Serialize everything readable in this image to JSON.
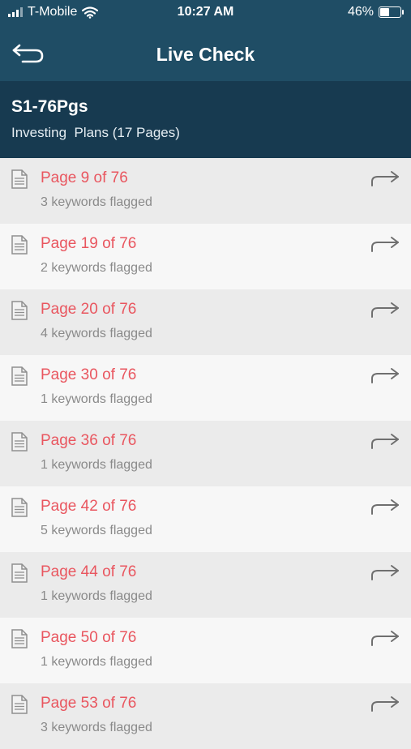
{
  "status_bar": {
    "carrier": "T-Mobile",
    "time": "10:27 AM",
    "battery_percent": "46%",
    "battery_level": 0.46,
    "icons": [
      "signal-icon",
      "wifi-icon",
      "battery-icon"
    ]
  },
  "nav": {
    "title": "Live Check",
    "back_icon": "back-return-icon"
  },
  "document": {
    "title": "S1-76Pgs",
    "subtitle": "Investing  Plans (17 Pages)"
  },
  "colors": {
    "nav_bg": "#1f4d65",
    "header_bg": "#173a50",
    "accent_red": "#e9565f",
    "muted_text": "#8a8a8a"
  },
  "flagged_pages": [
    {
      "title": "Page 9 of 76",
      "detail": "3 keywords flagged"
    },
    {
      "title": "Page 19 of 76",
      "detail": "2 keywords flagged"
    },
    {
      "title": "Page 20 of 76",
      "detail": "4 keywords flagged"
    },
    {
      "title": "Page 30 of 76",
      "detail": "1 keywords flagged"
    },
    {
      "title": "Page 36 of 76",
      "detail": "1 keywords flagged"
    },
    {
      "title": "Page 42 of 76",
      "detail": "5 keywords flagged"
    },
    {
      "title": "Page 44 of 76",
      "detail": "1 keywords flagged"
    },
    {
      "title": "Page 50 of 76",
      "detail": "1 keywords flagged"
    },
    {
      "title": "Page 53 of 76",
      "detail": "3 keywords flagged"
    }
  ]
}
